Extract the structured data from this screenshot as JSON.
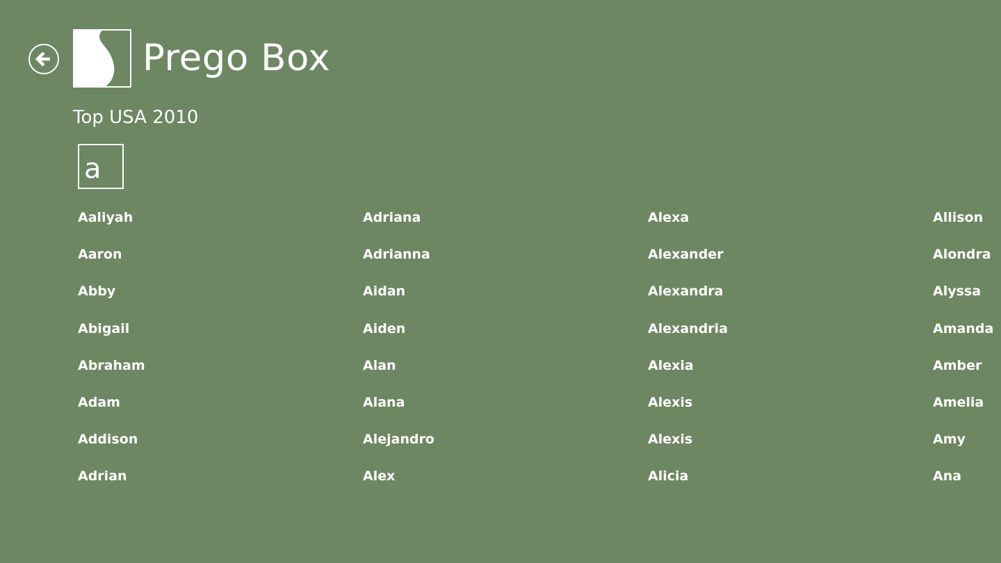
{
  "theme": {
    "background": "#6c8762",
    "foreground": "#ffffff"
  },
  "header": {
    "back_icon": "back-arrow-icon",
    "logo_icon": "pregnant-silhouette-icon",
    "title": "Prego Box"
  },
  "section": {
    "subtitle": "Top USA 2010",
    "group_letter": "a"
  },
  "names": [
    "Aaliyah",
    "Aaron",
    "Abby",
    "Abigail",
    "Abraham",
    "Adam",
    "Addison",
    "Adrian",
    "Adriana",
    "Adrianna",
    "Aidan",
    "Aiden",
    "Alan",
    "Alana",
    "Alejandro",
    "Alex",
    "Alexa",
    "Alexander",
    "Alexandra",
    "Alexandria",
    "Alexia",
    "Alexis",
    "Alexis",
    "Alicia",
    "Allison",
    "Alondra",
    "Alyssa",
    "Amanda",
    "Amber",
    "Amelia",
    "Amy",
    "Ana"
  ]
}
